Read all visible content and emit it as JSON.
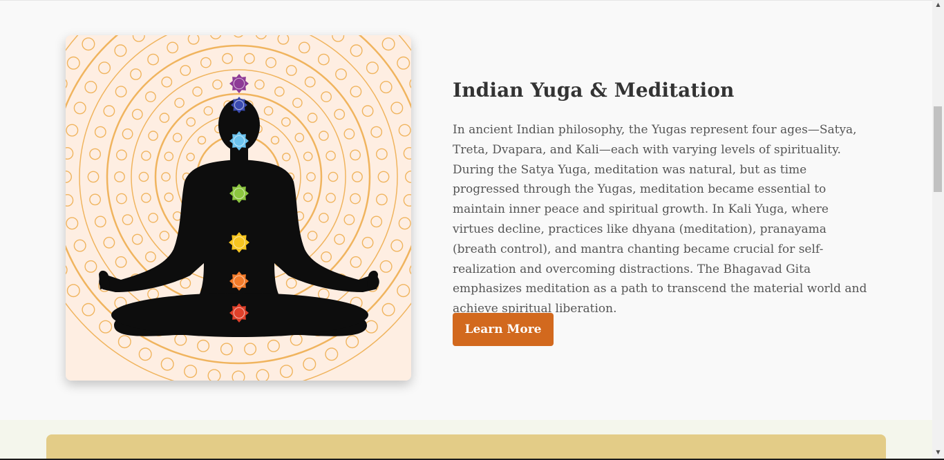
{
  "meditation_section": {
    "image_alt": "Meditation chakra silhouette",
    "title": "Indian Yuga & Meditation",
    "body": "In ancient Indian philosophy, the Yugas represent four ages—Satya, Treta, Dvapara, and Kali—each with varying levels of spirituality. During the Satya Yuga, meditation was natural, but as time progressed through the Yugas, meditation became essential to maintain inner peace and spiritual growth. In Kali Yuga, where virtues decline, practices like dhyana (meditation), pranayama (breath control), and mantra chanting became crucial for self-realization and overcoming distractions. The Bhagavad Gita emphasizes meditation as a path to transcend the material world and achieve spiritual liberation.",
    "button_label": "Learn More"
  },
  "colors": {
    "accent": "#d2691e",
    "title": "#333333",
    "body_text": "#555555",
    "image_background": "#feeee2",
    "mandala": "#f0b45e",
    "lower_card": "#e3cc87"
  },
  "chakras": [
    {
      "name": "crown",
      "color": "#8e3a96"
    },
    {
      "name": "third-eye",
      "color": "#3a4bb0"
    },
    {
      "name": "throat",
      "color": "#6cc3ee"
    },
    {
      "name": "heart",
      "color": "#8cc63f"
    },
    {
      "name": "solar-plexus",
      "color": "#f7c520"
    },
    {
      "name": "sacral",
      "color": "#f37b2a"
    },
    {
      "name": "root",
      "color": "#e0402a"
    }
  ],
  "scrollbar": {
    "up_icon": "triangle-up-icon",
    "down_icon": "triangle-down-icon"
  }
}
